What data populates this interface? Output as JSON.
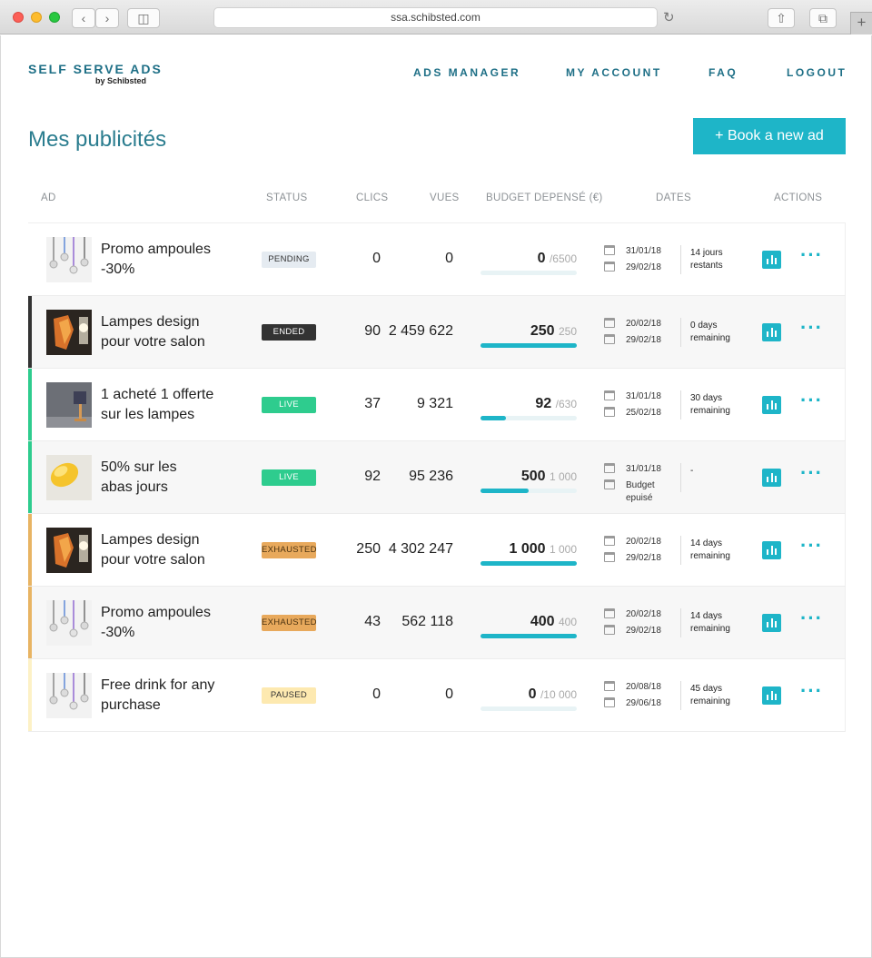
{
  "browser": {
    "url": "ssa.schibsted.com"
  },
  "logo": {
    "main": "SELF SERVE ADS",
    "sub": "by Schibsted"
  },
  "nav": [
    {
      "label": "ADS MANAGER"
    },
    {
      "label": "MY ACCOUNT"
    },
    {
      "label": "FAQ"
    },
    {
      "label": "LOGOUT"
    }
  ],
  "page_title": "Mes publicités",
  "book_button": "+ Book a new ad",
  "columns": {
    "ad": "AD",
    "status": "STATUS",
    "clics": "CLICS",
    "vues": "VUES",
    "budget": "BUDGET DEPENSÉ (€)",
    "dates": "DATES",
    "actions": "ACTIONS"
  },
  "colors": {
    "accent": "#1eb5c8",
    "pending": "#e5ebf1",
    "ended": "#333333",
    "live": "#2ecc8e",
    "exhausted": "#e8a95c",
    "paused": "#fde9b0"
  },
  "rows": [
    {
      "name_line1": "Promo ampoules",
      "name_line2": "-30%",
      "thumb": "bulbs",
      "status": "PENDING",
      "status_kind": "pending",
      "clics": "0",
      "vues": "0",
      "budget_spent": "0",
      "budget_max": "/6500",
      "budget_fraction": 0,
      "date1": "31/01/18",
      "date2": "29/02/18",
      "remain1": "14 jours",
      "remain2": "restants"
    },
    {
      "name_line1": "Lampes design",
      "name_line2": "pour votre salon",
      "thumb": "lamp",
      "status": "ENDED",
      "status_kind": "ended",
      "clics": "90",
      "vues": "2 459 622",
      "budget_spent": "250",
      "budget_max": "250",
      "budget_fraction": 1,
      "date1": "20/02/18",
      "date2": "29/02/18",
      "remain1": "0 days",
      "remain2": "remaining"
    },
    {
      "name_line1": "1 acheté 1 offerte",
      "name_line2": "sur les lampes",
      "thumb": "desk",
      "status": "LIVE",
      "status_kind": "live",
      "clics": "37",
      "vues": "9 321",
      "budget_spent": "92",
      "budget_max": "/630",
      "budget_fraction": 0.26,
      "date1": "31/01/18",
      "date2": "25/02/18",
      "remain1": "30 days",
      "remain2": "remaining"
    },
    {
      "name_line1": "50% sur les",
      "name_line2": "abas jours",
      "thumb": "yellow",
      "status": "LIVE",
      "status_kind": "live",
      "clics": "92",
      "vues": "95 236",
      "budget_spent": "500",
      "budget_max": "1 000",
      "budget_fraction": 0.5,
      "date1": "31/01/18",
      "date2": "Budget",
      "date3": "epuisé",
      "remain1": "-",
      "remain2": ""
    },
    {
      "name_line1": "Lampes design",
      "name_line2": "pour votre salon",
      "thumb": "lamp",
      "status": "EXHAUSTED",
      "status_kind": "exhausted",
      "clics": "250",
      "vues": "4 302 247",
      "budget_spent": "1 000",
      "budget_max": "1 000",
      "budget_fraction": 1,
      "date1": "20/02/18",
      "date2": "29/02/18",
      "remain1": "14 days",
      "remain2": "remaining"
    },
    {
      "name_line1": "Promo ampoules",
      "name_line2": "-30%",
      "thumb": "bulbs",
      "status": "EXHAUSTED",
      "status_kind": "exhausted",
      "clics": "43",
      "vues": "562 118",
      "budget_spent": "400",
      "budget_max": "400",
      "budget_fraction": 1,
      "date1": "20/02/18",
      "date2": "29/02/18",
      "remain1": "14 days",
      "remain2": "remaining"
    },
    {
      "name_line1": "Free drink for any",
      "name_line2": "purchase",
      "thumb": "bulbs",
      "status": "PAUSED",
      "status_kind": "paused",
      "clics": "0",
      "vues": "0",
      "budget_spent": "0",
      "budget_max": "/10 000",
      "budget_fraction": 0,
      "date1": "20/08/18",
      "date2": "29/06/18",
      "remain1": "45 days",
      "remain2": " remaining"
    }
  ]
}
